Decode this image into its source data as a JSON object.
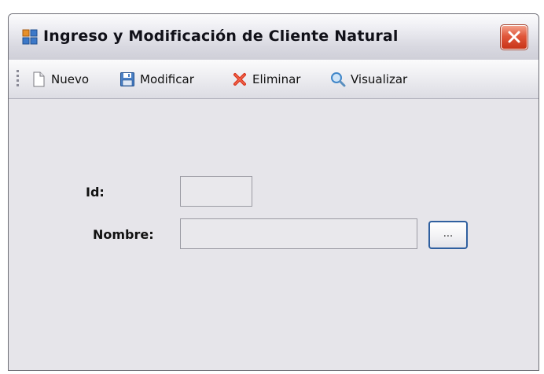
{
  "window": {
    "title": "Ingreso y Modificación de Cliente Natural"
  },
  "toolbar": {
    "items": [
      {
        "label": "Nuevo",
        "icon": "new-document-icon"
      },
      {
        "label": "Modificar",
        "icon": "save-disk-icon"
      },
      {
        "label": "Eliminar",
        "icon": "delete-x-icon"
      },
      {
        "label": "Visualizar",
        "icon": "magnifier-icon"
      }
    ]
  },
  "form": {
    "id_label": "Id:",
    "id_value": "",
    "nombre_label": "Nombre:",
    "nombre_value": "",
    "browse_label": "..."
  },
  "colors": {
    "window_bg": "#e6e5ea",
    "close_button": "#e0573b",
    "browse_border": "#2f5f9f"
  }
}
